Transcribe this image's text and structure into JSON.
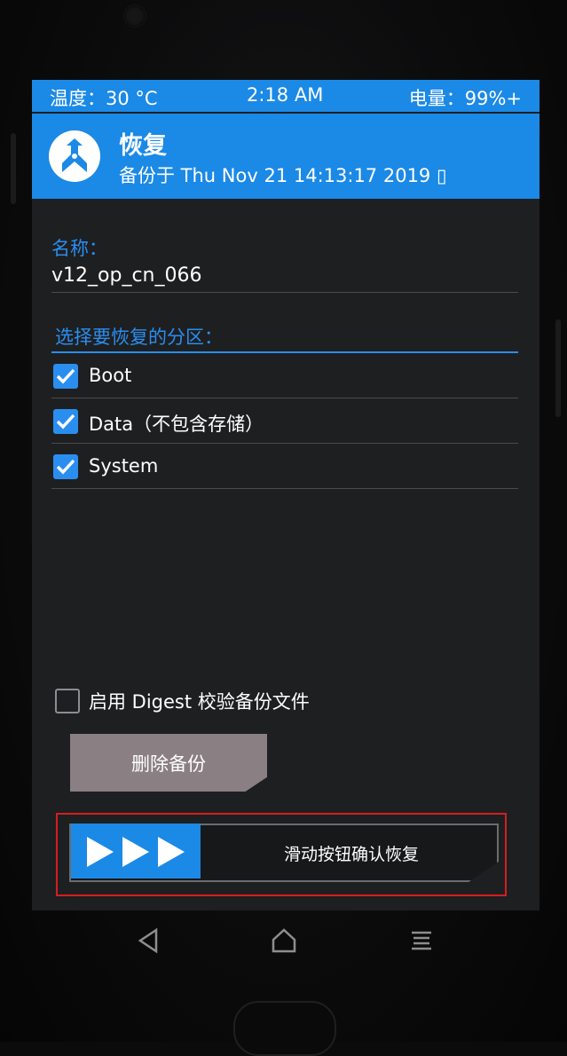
{
  "status_bar": {
    "temperature": "温度：30 °C",
    "time": "2:18 AM",
    "battery": "电量：99%+"
  },
  "header": {
    "logo_icon": "twrp-logo-icon",
    "title": "恢复",
    "subtitle": "备份于 Thu Nov 21 14:13:17 2019 ▯"
  },
  "name_section": {
    "label": "名称：",
    "value": "v12_op_cn_066"
  },
  "partitions": {
    "label": "选择要恢复的分区：",
    "items": [
      {
        "label": "Boot",
        "checked": true
      },
      {
        "label": "Data（不包含存储）",
        "checked": true
      },
      {
        "label": "System",
        "checked": true
      }
    ]
  },
  "digest": {
    "label": "启用 Digest 校验备份文件",
    "checked": false
  },
  "delete_button": {
    "label": "删除备份"
  },
  "swipe": {
    "label": "滑动按钮确认恢复",
    "handle_icon": "triple-arrow-icon"
  },
  "nav_bar": {
    "back_icon": "back-triangle-icon",
    "home_icon": "home-icon",
    "menu_icon": "menu-lines-icon"
  },
  "colors": {
    "accent": "#1b89e6",
    "highlight_outline": "#d21f1f"
  }
}
